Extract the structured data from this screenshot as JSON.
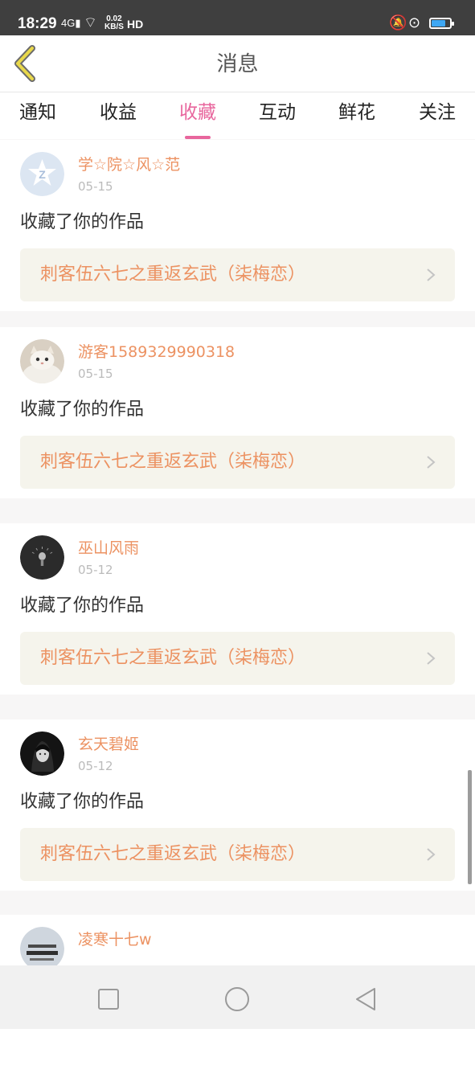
{
  "status_bar": {
    "time": "18:29",
    "signal": "4G",
    "net_speed_value": "0.02",
    "net_speed_unit": "KB/S",
    "hd": "HD",
    "battery_level": 0.75
  },
  "header": {
    "title": "消息"
  },
  "tabs": [
    {
      "label": "通知",
      "active": false
    },
    {
      "label": "收益",
      "active": false
    },
    {
      "label": "收藏",
      "active": true
    },
    {
      "label": "互动",
      "active": false
    },
    {
      "label": "鲜花",
      "active": false
    },
    {
      "label": "关注",
      "active": false
    }
  ],
  "messages": [
    {
      "username": "学☆院☆风☆范",
      "date": "05-15",
      "text": "收藏了你的作品",
      "work_title": "刺客伍六七之重返玄武（柒梅恋）",
      "avatar": "qq-default-avatar"
    },
    {
      "username": "游客1589329990318",
      "date": "05-15",
      "text": "收藏了你的作品",
      "work_title": "刺客伍六七之重返玄武（柒梅恋）",
      "avatar": "kitten-avatar"
    },
    {
      "username": "巫山风雨",
      "date": "05-12",
      "text": "收藏了你的作品",
      "work_title": "刺客伍六七之重返玄武（柒梅恋）",
      "avatar": "dark-lamp-avatar"
    },
    {
      "username": "玄天碧姬",
      "date": "05-12",
      "text": "收藏了你的作品",
      "work_title": "刺客伍六七之重返玄武（柒梅恋）",
      "avatar": "anime-girl-avatar"
    },
    {
      "username": "凌寒十七w",
      "date": "",
      "text": "",
      "work_title": "",
      "avatar": "text-image-avatar"
    }
  ],
  "colors": {
    "accent": "#e8669d",
    "username": "#ec9262",
    "work_bg": "#f5f4ec",
    "back_arrow": "#e9d84a"
  }
}
